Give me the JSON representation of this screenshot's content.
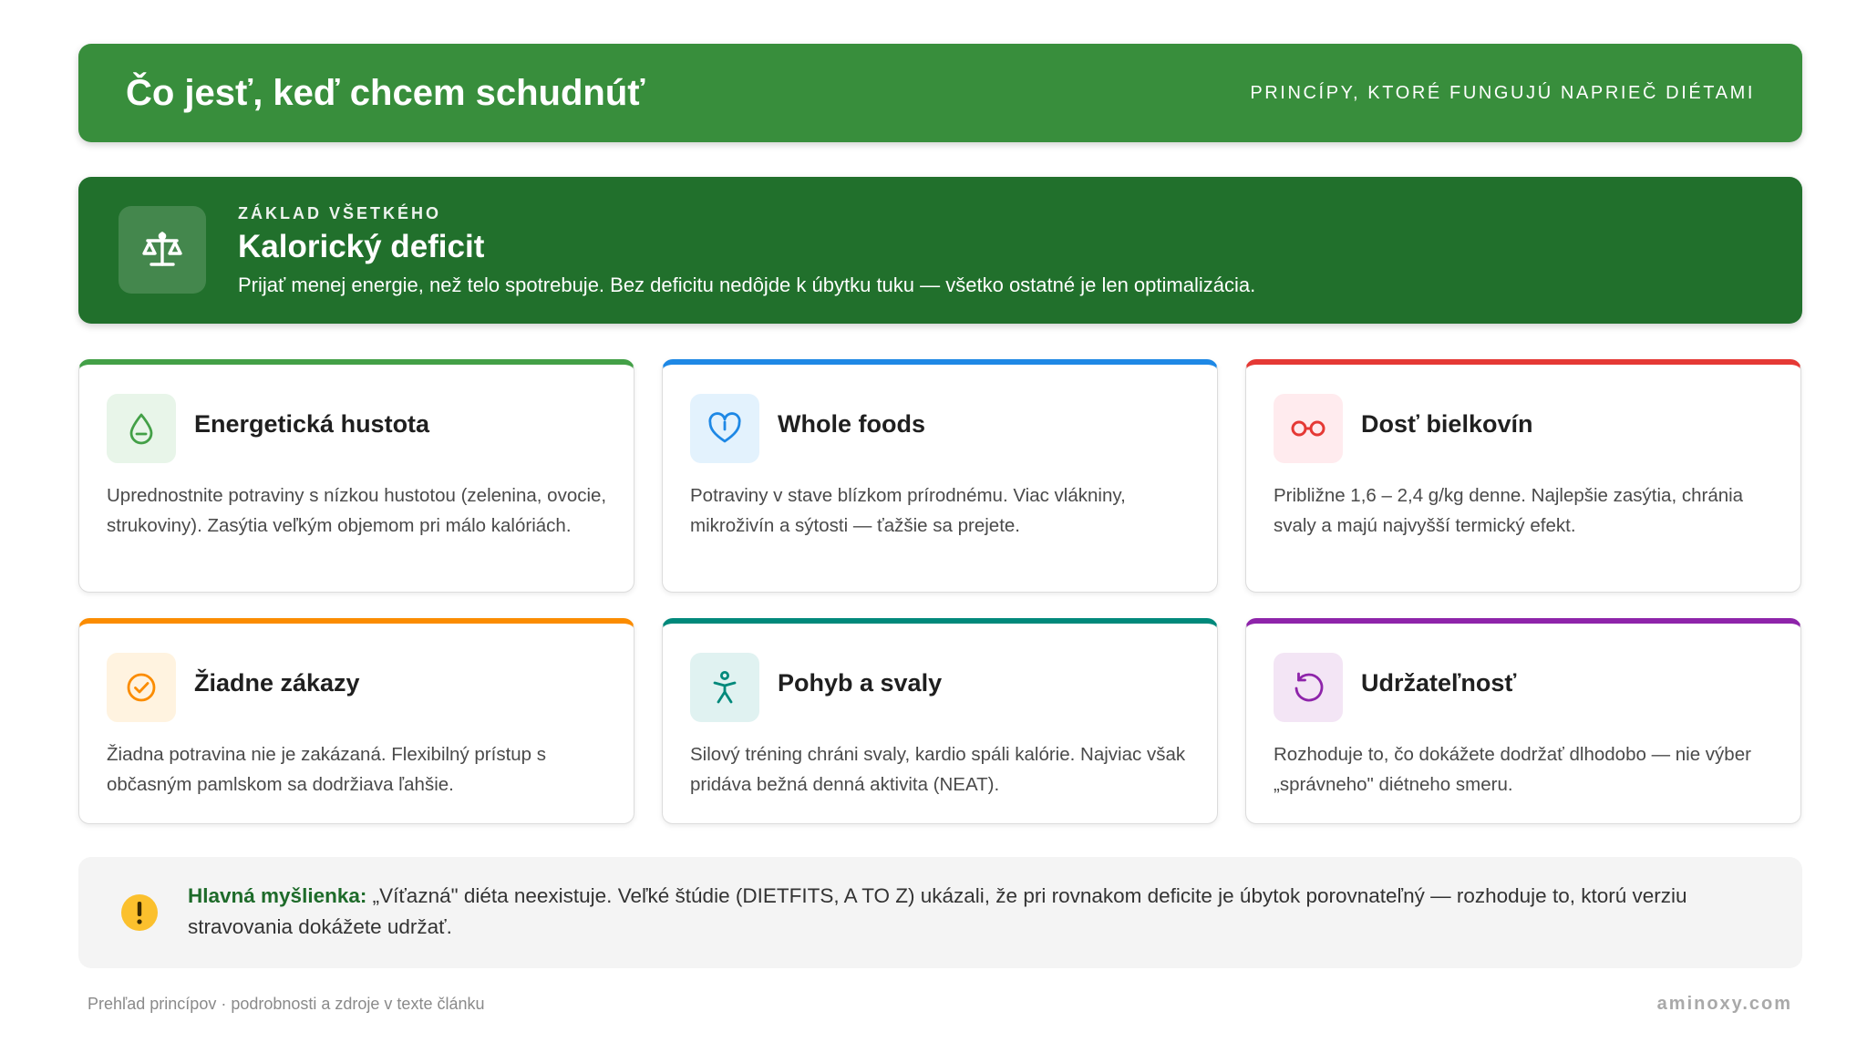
{
  "header": {
    "title": "Čo jesť, keď chcem schudnúť",
    "subtitle": "PRINCÍPY, KTORÉ FUNGUJÚ NAPRIEČ DIÉTAMI"
  },
  "hero": {
    "icon": "scale-icon",
    "kicker": "ZÁKLAD VŠETKÉHO",
    "title": "Kalorický deficit",
    "description": "Prijať menej energie, než telo spotrebuje. Bez deficitu nedôjde k úbytku tuku — všetko ostatné je len optimalizácia."
  },
  "cards": [
    {
      "icon": "droplet-icon",
      "accent": "#43a047",
      "icon_bg": "#e8f5e9",
      "title": "Energetická hustota",
      "description": "Uprednostnite potraviny s nízkou hustotou (zelenina, ovocie, strukoviny). Zasýtia veľkým objemom pri málo kalóriách."
    },
    {
      "icon": "heart-icon",
      "accent": "#1e88e5",
      "icon_bg": "#e3f2fd",
      "title": "Whole foods",
      "description": "Potraviny v stave blízkom prírodnému. Viac vlákniny, mikroživín a sýtosti — ťažšie sa prejete."
    },
    {
      "icon": "infinity-icon",
      "accent": "#e53935",
      "icon_bg": "#ffebee",
      "title": "Dosť bielkovín",
      "description": "Približne 1,6 – 2,4 g/kg denne. Najlepšie zasýtia, chránia svaly a majú najvyšší termický efekt."
    },
    {
      "icon": "check-circle-icon",
      "accent": "#fb8c00",
      "icon_bg": "#fff3e0",
      "title": "Žiadne zákazy",
      "description": "Žiadna potravina nie je zakázaná. Flexibilný prístup s občasným pamlskom sa dodržiava ľahšie."
    },
    {
      "icon": "person-icon",
      "accent": "#00897b",
      "icon_bg": "#e0f2f1",
      "title": "Pohyb a svaly",
      "description": "Silový tréning chráni svaly, kardio spáli kalórie. Najviac však pridáva bežná denná aktivita (NEAT)."
    },
    {
      "icon": "rotate-icon",
      "accent": "#8e24aa",
      "icon_bg": "#f3e5f5",
      "title": "Udržateľnosť",
      "description": "Rozhoduje to, čo dokážete dodržať dlhodobo — nie výber „správneho\" diétneho smeru."
    }
  ],
  "note": {
    "icon": "warning-icon",
    "label": "Hlavná myšlienka:",
    "text": " „Víťazná\" diéta neexistuje. Veľké štúdie (DIETFITS, A TO Z) ukázali, že pri rovnakom deficite je úbytok porovnateľný — rozhoduje to, ktorú verziu stravovania dokážete udržať."
  },
  "footer": {
    "left": "Prehľad princípov · podrobnosti a zdroje v texte článku",
    "right": "aminoxy.com"
  },
  "colors": {
    "header_bg": "#388e3c",
    "hero_bg": "#21702c",
    "note_icon": "#fbc02d"
  }
}
